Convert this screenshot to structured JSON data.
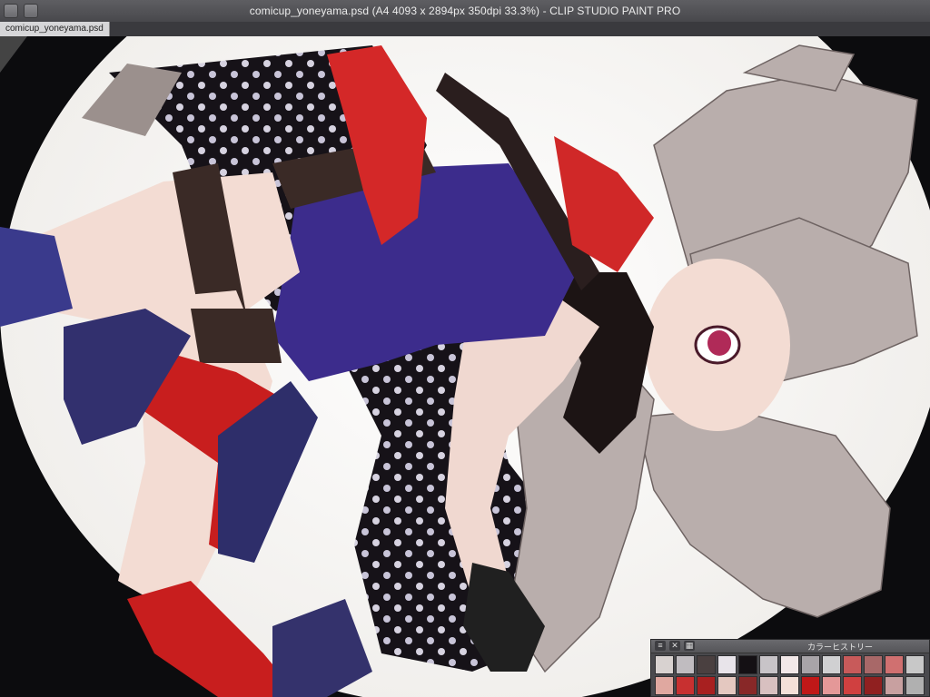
{
  "window": {
    "title": "comicup_yoneyama.psd (A4 4093 x 2894px 350dpi 33.3%)  - CLIP STUDIO PAINT PRO"
  },
  "tab": {
    "label": "comicup_yoneyama.psd"
  },
  "color_history": {
    "title": "カラーヒストリー",
    "icons": [
      "panel-menu-icon",
      "close-icon",
      "palette-icon"
    ],
    "swatches": [
      "#d8d2d0",
      "#c0bcc0",
      "#4a4040",
      "#e8e4ea",
      "#141014",
      "#c8c4c8",
      "#f2e8e8",
      "#a8a4a8",
      "#d0d0d2",
      "#c85a5a",
      "#a86868",
      "#d07070",
      "#c8c8c8",
      "#e0a8a0",
      "#c83030",
      "#a82020",
      "#e4c8c0",
      "#882828",
      "#d8c0c0",
      "#f4e0d8",
      "#c01818",
      "#e49898",
      "#d04040",
      "#902020",
      "#c8a0a0",
      "#b0b0b0"
    ]
  }
}
